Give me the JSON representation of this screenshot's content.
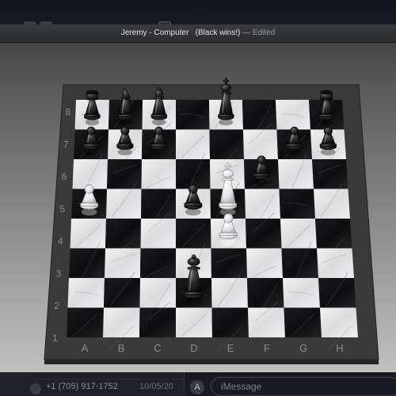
{
  "window": {
    "title_main": "Jeremy - Computer",
    "title_result": "(Black wins!)",
    "title_dash": "—",
    "title_edited": "Edited"
  },
  "board": {
    "ranks": [
      "8",
      "7",
      "6",
      "5",
      "4",
      "3",
      "2",
      "1"
    ],
    "files": [
      "A",
      "B",
      "C",
      "D",
      "E",
      "F",
      "G",
      "H"
    ],
    "pieces": [
      {
        "square": "a8",
        "piece": "rook",
        "color": "black",
        "icon": "black-rook-icon"
      },
      {
        "square": "b8",
        "piece": "knight",
        "color": "black",
        "icon": "black-knight-icon"
      },
      {
        "square": "c8",
        "piece": "bishop",
        "color": "black",
        "icon": "black-bishop-icon"
      },
      {
        "square": "e8",
        "piece": "king",
        "color": "black",
        "icon": "black-king-icon"
      },
      {
        "square": "h8",
        "piece": "rook",
        "color": "black",
        "icon": "black-rook-icon"
      },
      {
        "square": "a7",
        "piece": "pawn",
        "color": "black",
        "icon": "black-pawn-icon"
      },
      {
        "square": "b7",
        "piece": "pawn",
        "color": "black",
        "icon": "black-pawn-icon"
      },
      {
        "square": "c7",
        "piece": "pawn",
        "color": "black",
        "icon": "black-pawn-icon"
      },
      {
        "square": "g7",
        "piece": "pawn",
        "color": "black",
        "icon": "black-pawn-icon"
      },
      {
        "square": "h7",
        "piece": "pawn",
        "color": "black",
        "icon": "black-pawn-icon"
      },
      {
        "square": "f6",
        "piece": "pawn",
        "color": "black",
        "icon": "black-pawn-icon"
      },
      {
        "square": "d5",
        "piece": "pawn",
        "color": "black",
        "icon": "black-pawn-icon"
      },
      {
        "square": "d2",
        "piece": "queen",
        "color": "black",
        "icon": "black-queen-icon"
      },
      {
        "square": "a5",
        "piece": "pawn",
        "color": "white",
        "icon": "white-pawn-icon"
      },
      {
        "square": "e5",
        "piece": "king",
        "color": "white",
        "icon": "white-king-icon"
      },
      {
        "square": "e4",
        "piece": "pawn",
        "color": "white",
        "icon": "white-pawn-icon"
      }
    ],
    "colors": {
      "light_square": "#e6e6e8",
      "dark_square": "#141416",
      "frame": "#3a3a3a",
      "label": "#8e8e8e",
      "black_piece": "#2b2b2d",
      "white_piece": "#e9e9eb"
    }
  },
  "background": {
    "contact_number": "+1 (705) 917-1752",
    "contact_date": "10/05/20",
    "message_placeholder": "iMessage",
    "apps_icon": "app-store-icon"
  }
}
